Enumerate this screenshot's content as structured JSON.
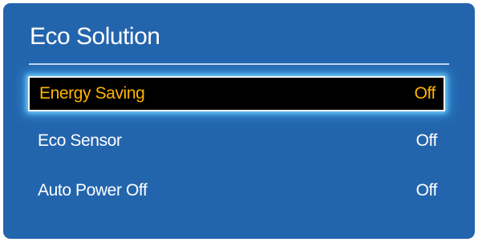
{
  "window": {
    "title": "Eco Solution"
  },
  "menu": {
    "items": [
      {
        "label": "Energy Saving",
        "value": "Off",
        "selected": true
      },
      {
        "label": "Eco Sensor",
        "value": "Off",
        "selected": false
      },
      {
        "label": "Auto Power Off",
        "value": "Off",
        "selected": false
      }
    ]
  },
  "colors": {
    "panel_background": "#2365ad",
    "selected_background": "#000000",
    "selected_text": "#ffb400",
    "text": "#ffffff",
    "focus_glow": "#78d7ff"
  }
}
